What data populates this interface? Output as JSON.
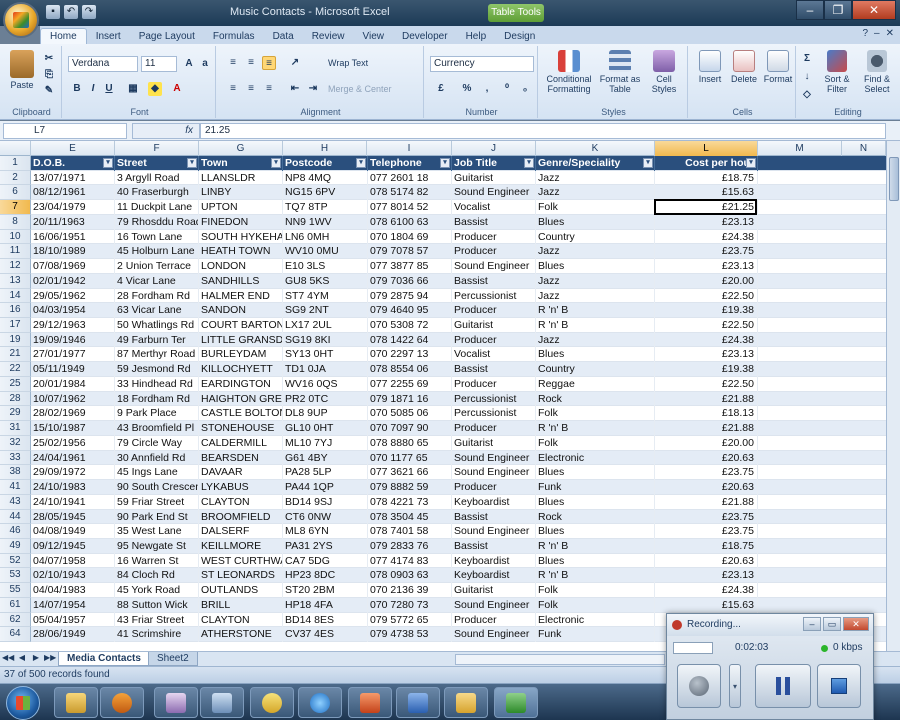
{
  "window": {
    "title": "Music Contacts - Microsoft Excel",
    "tools_badge": "Table Tools",
    "quick_access": [
      "save-icon",
      "undo-icon",
      "redo-icon"
    ],
    "controls": {
      "minimize": "–",
      "restore": "❐",
      "close": "✕"
    }
  },
  "ribbon": {
    "tabs": [
      "Home",
      "Insert",
      "Page Layout",
      "Formulas",
      "Data",
      "Review",
      "View",
      "Developer",
      "Help",
      "Design"
    ],
    "active_tab": "Home",
    "clipboard": {
      "paste": "Paste",
      "label": "Clipboard"
    },
    "font": {
      "name": "Verdana",
      "size": "11",
      "label": "Font",
      "bold": "B",
      "italic": "I",
      "underline": "U"
    },
    "alignment": {
      "wrap": "Wrap Text",
      "merge": "Merge & Center",
      "label": "Alignment"
    },
    "number": {
      "format": "Currency",
      "label": "Number",
      "currency": "£",
      "percent": "%",
      "comma": ","
    },
    "styles": {
      "conditional": "Conditional Formatting",
      "format_table": "Format as Table",
      "cell_styles": "Cell Styles",
      "label": "Styles"
    },
    "cells": {
      "insert": "Insert",
      "delete": "Delete",
      "format": "Format",
      "label": "Cells"
    },
    "editing": {
      "sort": "Sort & Filter",
      "find": "Find & Select",
      "label": "Editing"
    }
  },
  "formula_bar": {
    "name_box": "L7",
    "fx": "fx",
    "value": "21.25"
  },
  "columns": [
    "E",
    "F",
    "G",
    "H",
    "I",
    "J",
    "K",
    "L",
    "M",
    "N"
  ],
  "selected_column": "L",
  "table": {
    "headers": [
      "D.O.B.",
      "Street",
      "Town",
      "Postcode",
      "Telephone",
      "Job Title",
      "Genre/Speciality",
      "Cost per hour"
    ],
    "rows": [
      {
        "n": "2",
        "cells": [
          "13/07/1971",
          "3 Argyll Road",
          "LLANSLDR",
          "NP8 4MQ",
          "077 2601 18",
          "Guitarist",
          "Jazz",
          "£18.75"
        ]
      },
      {
        "n": "6",
        "cells": [
          "08/12/1961",
          "40 Fraserburgh",
          "LINBY",
          "NG15 6PV",
          "078 5174 82",
          "Sound Engineer",
          "Jazz",
          "£15.63"
        ]
      },
      {
        "n": "7",
        "cells": [
          "23/04/1979",
          "11 Duckpit Lane",
          "UPTON",
          "TQ7 8TP",
          "077 8014 52",
          "Vocalist",
          "Folk",
          "£21.25"
        ]
      },
      {
        "n": "8",
        "cells": [
          "20/11/1963",
          "79 Rhosddu Road",
          "FINEDON",
          "NN9 1WV",
          "078 6100 63",
          "Bassist",
          "Blues",
          "£23.13"
        ]
      },
      {
        "n": "10",
        "cells": [
          "16/06/1951",
          "16 Town Lane",
          "SOUTH HYKEHAM",
          "LN6 0MH",
          "070 1804 69",
          "Producer",
          "Country",
          "£24.38"
        ]
      },
      {
        "n": "11",
        "cells": [
          "18/10/1989",
          "45 Holburn Lane",
          "HEATH TOWN",
          "WV10 0MU",
          "079 7078 57",
          "Producer",
          "Jazz",
          "£23.75"
        ]
      },
      {
        "n": "12",
        "cells": [
          "07/08/1969",
          "2 Union Terrace",
          "LONDON",
          "E10 3LS",
          "077 3877 85",
          "Sound Engineer",
          "Blues",
          "£23.13"
        ]
      },
      {
        "n": "13",
        "cells": [
          "02/01/1942",
          "4 Vicar Lane",
          "SANDHILLS",
          "GU8 5KS",
          "079 7036 66",
          "Bassist",
          "Jazz",
          "£20.00"
        ]
      },
      {
        "n": "14",
        "cells": [
          "29/05/1962",
          "28 Fordham Rd",
          "HALMER END",
          "ST7 4YM",
          "079 2875 94",
          "Percussionist",
          "Jazz",
          "£22.50"
        ]
      },
      {
        "n": "16",
        "cells": [
          "04/03/1954",
          "63 Vicar Lane",
          "SANDON",
          "SG9 2NT",
          "079 4640 95",
          "Producer",
          "R 'n' B",
          "£19.38"
        ]
      },
      {
        "n": "17",
        "cells": [
          "29/12/1963",
          "50 Whatlings Rd",
          "COURT BARTON",
          "LX17 2UL",
          "070 5308 72",
          "Guitarist",
          "R 'n' B",
          "£22.50"
        ]
      },
      {
        "n": "19",
        "cells": [
          "19/09/1946",
          "49 Farburn Ter",
          "LITTLE GRANSDEN",
          "SG19 8KI",
          "078 1422 64",
          "Producer",
          "Jazz",
          "£24.38"
        ]
      },
      {
        "n": "21",
        "cells": [
          "27/01/1977",
          "87 Merthyr Road",
          "BURLEYDAM",
          "SY13 0HT",
          "070 2297 13",
          "Vocalist",
          "Blues",
          "£23.13"
        ]
      },
      {
        "n": "22",
        "cells": [
          "05/11/1949",
          "59 Jesmond Rd",
          "KILLOCHYETT",
          "TD1 0JA",
          "078 8554 06",
          "Bassist",
          "Country",
          "£19.38"
        ]
      },
      {
        "n": "25",
        "cells": [
          "20/01/1984",
          "33 Hindhead Rd",
          "EARDINGTON",
          "WV16 0QS",
          "077 2255 69",
          "Producer",
          "Reggae",
          "£22.50"
        ]
      },
      {
        "n": "28",
        "cells": [
          "10/07/1962",
          "18 Fordham Rd",
          "HAIGHTON GREEN",
          "PR2 0TC",
          "079 1871 16",
          "Percussionist",
          "Rock",
          "£21.88"
        ]
      },
      {
        "n": "29",
        "cells": [
          "28/02/1969",
          "9 Park Place",
          "CASTLE BOLTON",
          "DL8 9UP",
          "070 5085 06",
          "Percussionist",
          "Folk",
          "£18.13"
        ]
      },
      {
        "n": "31",
        "cells": [
          "15/10/1987",
          "43 Broomfield Pl",
          "STONEHOUSE",
          "GL10 0HT",
          "070 7097 90",
          "Producer",
          "R 'n' B",
          "£21.88"
        ]
      },
      {
        "n": "32",
        "cells": [
          "25/02/1956",
          "79 Circle Way",
          "CALDERMILL",
          "ML10 7YJ",
          "078 8880 65",
          "Guitarist",
          "Folk",
          "£20.00"
        ]
      },
      {
        "n": "33",
        "cells": [
          "24/04/1961",
          "30 Annfield Rd",
          "BEARSDEN",
          "G61 4BY",
          "070 1177 65",
          "Sound Engineer",
          "Electronic",
          "£20.63"
        ]
      },
      {
        "n": "38",
        "cells": [
          "29/09/1972",
          "45 Ings Lane",
          "DAVAAR",
          "PA28 5LP",
          "077 3621 66",
          "Sound Engineer",
          "Blues",
          "£23.75"
        ]
      },
      {
        "n": "41",
        "cells": [
          "24/10/1983",
          "90 South Crescent",
          "LYKABUS",
          "PA44 1QP",
          "079 8882 59",
          "Producer",
          "Funk",
          "£20.63"
        ]
      },
      {
        "n": "43",
        "cells": [
          "24/10/1941",
          "59 Friar Street",
          "CLAYTON",
          "BD14 9SJ",
          "078 4221 73",
          "Keyboardist",
          "Blues",
          "£21.88"
        ]
      },
      {
        "n": "44",
        "cells": [
          "28/05/1945",
          "90 Park End St",
          "BROOMFIELD",
          "CT6 0NW",
          "078 3504 45",
          "Bassist",
          "Rock",
          "£23.75"
        ]
      },
      {
        "n": "46",
        "cells": [
          "04/08/1949",
          "35 West Lane",
          "DALSERF",
          "ML8 6YN",
          "078 7401 58",
          "Sound Engineer",
          "Blues",
          "£23.75"
        ]
      },
      {
        "n": "49",
        "cells": [
          "09/12/1945",
          "95 Newgate St",
          "KEILLMORE",
          "PA31 2YS",
          "079 2833 76",
          "Bassist",
          "R 'n' B",
          "£18.75"
        ]
      },
      {
        "n": "52",
        "cells": [
          "04/07/1958",
          "16 Warren St",
          "WEST CURTHWAITE",
          "CA7 5DG",
          "077 4174 83",
          "Keyboardist",
          "Blues",
          "£20.63"
        ]
      },
      {
        "n": "53",
        "cells": [
          "02/10/1943",
          "84 Cloch Rd",
          "ST LEONARDS",
          "HP23 8DC",
          "078 0903 63",
          "Keyboardist",
          "R 'n' B",
          "£23.13"
        ]
      },
      {
        "n": "55",
        "cells": [
          "04/04/1983",
          "45 York Road",
          "OUTLANDS",
          "ST20 2BM",
          "070 2136 39",
          "Guitarist",
          "Folk",
          "£24.38"
        ]
      },
      {
        "n": "61",
        "cells": [
          "14/07/1954",
          "88 Sutton Wick",
          "BRILL",
          "HP18 4FA",
          "070 7280 73",
          "Sound Engineer",
          "Folk",
          "£15.63"
        ]
      },
      {
        "n": "62",
        "cells": [
          "05/04/1957",
          "43 Friar Street",
          "CLAYTON",
          "BD14 8ES",
          "079 5772 65",
          "Producer",
          "Electronic",
          ""
        ]
      },
      {
        "n": "64",
        "cells": [
          "28/06/1949",
          "41 Scrimshire",
          "ATHERSTONE",
          "CV37 4ES",
          "079 4738 53",
          "Sound Engineer",
          "Funk",
          ""
        ]
      }
    ]
  },
  "sheets": {
    "tabs": [
      "Media Contacts",
      "Sheet2"
    ],
    "active": "Media Contacts"
  },
  "status": "37 of 500 records found",
  "recorder": {
    "title": "Recording...",
    "time": "0:02:03",
    "rate": "0 kbps"
  },
  "colors": {
    "table_header": "#2a4f7d",
    "band": "#e4ecf6",
    "ribbon": "#dfe9f5",
    "selected_header": "#f1b94e"
  }
}
